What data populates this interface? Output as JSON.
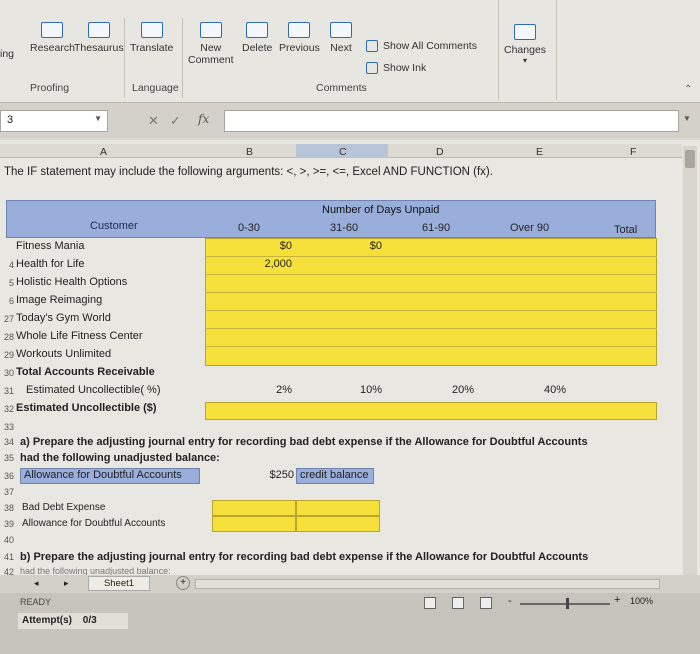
{
  "ribbon": {
    "spelling_partial": "ing",
    "research": "Research",
    "thesaurus": "Thesaurus",
    "translate": "Translate",
    "new_comment_1": "New",
    "new_comment_2": "Comment",
    "delete": "Delete",
    "previous": "Previous",
    "next": "Next",
    "show_all_comments": "Show All Comments",
    "show_ink": "Show Ink",
    "changes": "Changes",
    "groups": {
      "proofing": "Proofing",
      "language": "Language",
      "comments": "Comments"
    }
  },
  "formula_bar": {
    "name_box": "3",
    "fx": "fx",
    "value": ""
  },
  "columns": [
    "A",
    "B",
    "C",
    "D",
    "E",
    "F"
  ],
  "instruction": "The IF statement may include the following arguments: <, >, >=, <=, Excel AND FUNCTION (fx).",
  "aging": {
    "customer_header": "Customer",
    "days_unpaid_header": "Number of Days Unpaid",
    "buckets": [
      "0-30",
      "31-60",
      "61-90",
      "Over 90"
    ],
    "total_header": "Total",
    "rows": [
      {
        "row": "",
        "name": "Fitness Mania",
        "v0": "$0",
        "v1": "$0"
      },
      {
        "row": "4",
        "name": "Health for Life",
        "v0": "2,000",
        "v1": ""
      },
      {
        "row": "5",
        "name": "Holistic Health Options",
        "v0": "",
        "v1": ""
      },
      {
        "row": "6",
        "name": "Image Reimaging",
        "v0": "",
        "v1": ""
      },
      {
        "row": "27",
        "name": "Today's Gym World",
        "v0": "",
        "v1": ""
      },
      {
        "row": "28",
        "name": "Whole Life Fitness Center",
        "v0": "",
        "v1": ""
      },
      {
        "row": "29",
        "name": "Workouts Unlimited",
        "v0": "",
        "v1": ""
      }
    ],
    "total_ar_label": "Total Accounts Receivable",
    "total_ar_row": "30",
    "est_pct_label": "Estimated Uncollectible( %)",
    "est_pct_row": "31",
    "percentages": [
      "2%",
      "10%",
      "20%",
      "40%"
    ],
    "est_dollar_label": "Estimated Uncollectible ($)",
    "est_dollar_row": "32"
  },
  "questions": {
    "q_a_row": "34",
    "q_a": "a) Prepare the adjusting journal entry for recording bad debt expense if the Allowance for Doubtful Accounts",
    "q_a_cont_row": "35",
    "q_a_cont": "had the following unadjusted balance:",
    "allowance_row": "36",
    "allowance_label": "Allowance for Doubtful Accounts",
    "allowance_amount": "$250",
    "allowance_type": "credit balance",
    "blank_rows": [
      "33",
      "37",
      "40"
    ],
    "je_row1": "38",
    "je_line1": "Bad Debt Expense",
    "je_row2": "39",
    "je_line2": "Allowance for Doubtful Accounts",
    "q_b_row": "41",
    "q_b": "b) Prepare the adjusting journal entry for recording bad debt expense if the Allowance for Doubtful Accounts",
    "q_b_cont_row": "42",
    "q_b_cont": "had the following unadjusted balance:"
  },
  "sheet_tab": "Sheet1",
  "status": {
    "ready": "READY",
    "attempts_label": "Attempt(s)",
    "attempts_value": "0/3",
    "zoom": "100%"
  },
  "colors": {
    "yellow": "#f6e03c",
    "header_blue": "#9aaedb"
  }
}
